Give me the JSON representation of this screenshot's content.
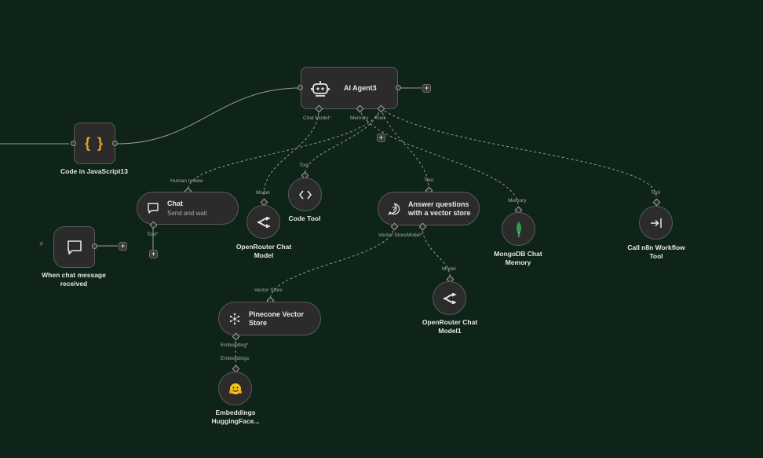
{
  "nodes": {
    "ai_agent": {
      "title": "AI Agent3",
      "icon": "robot-icon"
    },
    "code_js": {
      "label": "Code in JavaScript13",
      "glyph": "{ }"
    },
    "chat": {
      "title": "Chat",
      "subtitle": "Send and wait",
      "icon": "chat-bubble-icon"
    },
    "chat_trigger": {
      "label_line1": "When chat message",
      "label_line2": "received",
      "icon": "chat-bubble-icon"
    },
    "openrouter": {
      "label_line1": "OpenRouter Chat",
      "label_line2": "Model",
      "icon": "openrouter-icon"
    },
    "code_tool": {
      "label": "Code Tool",
      "icon": "code-brackets-icon"
    },
    "vector_qa": {
      "title_line1": "Answer questions",
      "title_line2": "with a vector store",
      "icon": "question-icon"
    },
    "mongodb": {
      "label_line1": "MongoDB Chat",
      "label_line2": "Memory",
      "icon": "mongodb-leaf-icon"
    },
    "n8n_workflow": {
      "label_line1": "Call n8n Workflow",
      "label_line2": "Tool",
      "icon": "workflow-arrow-icon"
    },
    "pinecone": {
      "title_line1": "Pinecone Vector",
      "title_line2": "Store",
      "icon": "pinecone-icon"
    },
    "openrouter1": {
      "label_line1": "OpenRouter Chat",
      "label_line2": "Model1",
      "icon": "openrouter-icon"
    },
    "hf_embeddings": {
      "label_line1": "Embeddings",
      "label_line2": "HuggingFace...",
      "icon": "huggingface-icon"
    }
  },
  "ports": {
    "chat_model": "Chat Model",
    "memory": "Memory",
    "tool": "Tool",
    "human_review": "Human review",
    "chat_tool": "Tool",
    "model": "Model",
    "code_tool_top": "Tool",
    "vqa_tool": "Tool",
    "mongo_memory": "Memory",
    "n8n_tool": "Tool",
    "vector_store": "Vector Store",
    "vqa_model": "Model",
    "pinecone_top": "Vector Store",
    "openrouter1_model": "Model",
    "embedding": "Embedding",
    "embeddings_top": "Embeddings"
  },
  "required_mark": "*",
  "colors": {
    "background": "#0e2418",
    "node_bg": "#2b2b2b",
    "node_border": "#5a5a5a",
    "required": "#ff6b6b",
    "code_accent": "#f0a030",
    "mongo_green": "#2e9e4f",
    "hf_yellow": "#f5c518"
  }
}
